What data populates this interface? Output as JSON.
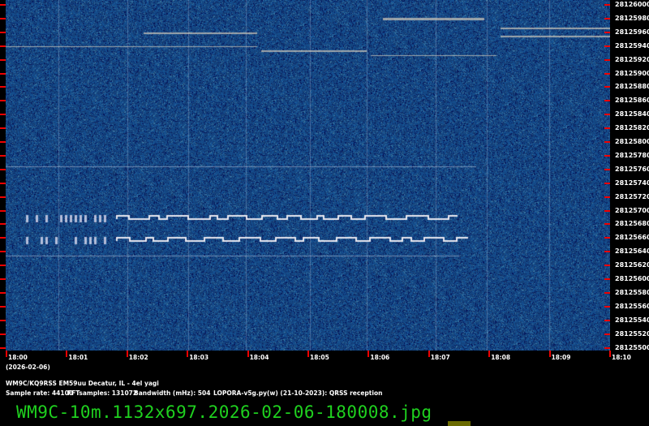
{
  "freq_labels": [
    "28126000",
    "28125980",
    "28125960",
    "28125940",
    "28125920",
    "28125900",
    "28125880",
    "28125860",
    "28125840",
    "28125820",
    "28125800",
    "28125780",
    "28125760",
    "28125740",
    "28125720",
    "28125700",
    "28125680",
    "28125660",
    "28125640",
    "28125620",
    "28125600",
    "28125580",
    "28125560",
    "28125540",
    "28125520",
    "28125500"
  ],
  "time_labels": [
    "18:00",
    "18:01",
    "18:02",
    "18:03",
    "18:04",
    "18:05",
    "18:06",
    "18:07",
    "18:08",
    "18:09",
    "18:10"
  ],
  "date_label": "(2026-02-06)",
  "station_line": "WM9C/KQ9RSS EM59uu Decatur, IL - 4el yagi",
  "sample_rate": "Sample rate: 44100",
  "fft_samples": "FFTsamples: 131072",
  "bandwidth": "Bandwidth (mHz): 504",
  "software": "LOPORA-v5g.py(w) (21-10-2023): QRSS reception",
  "filename": "WM9C-10m.1132x697.2026-02-06-180008.jpg",
  "colors": {
    "background": "#14306a",
    "tick": "#ee0000",
    "filename": "#1fd11f"
  }
}
